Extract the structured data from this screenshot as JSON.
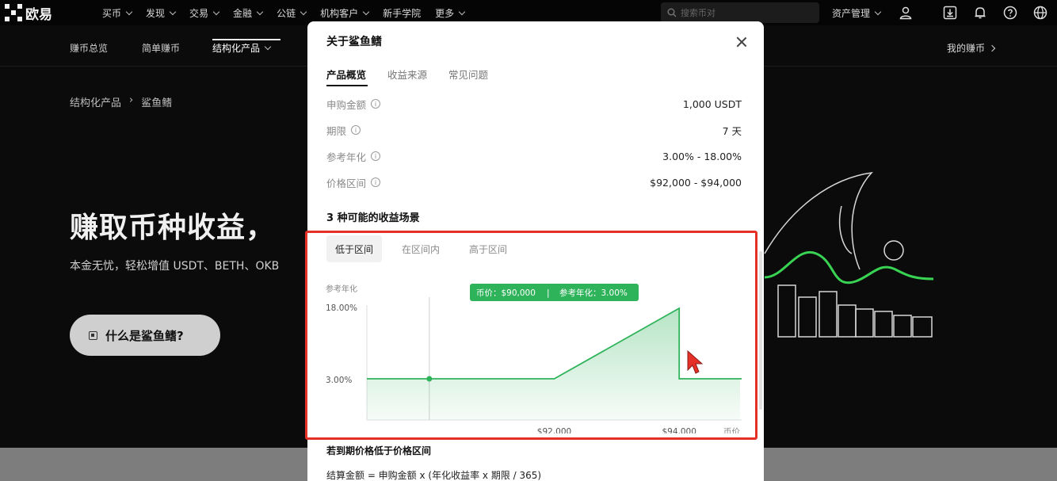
{
  "brand": {
    "name": "欧易"
  },
  "topnav": {
    "items": [
      "买币",
      "发现",
      "交易",
      "金融",
      "公链",
      "机构客户",
      "新手学院",
      "更多"
    ],
    "search_placeholder": "搜索币对",
    "assets_label": "资产管理"
  },
  "subnav": {
    "items": [
      "赚币总览",
      "简单赚币",
      "结构化产品"
    ],
    "my_earn": "我的赚币"
  },
  "hero": {
    "breadcrumb_parent": "结构化产品",
    "breadcrumb_sep": "›",
    "breadcrumb_current": "鲨鱼鳍",
    "title": "赚取币种收益，",
    "subtitle": "本金无忧，轻松增值 USDT、BETH、OKB",
    "button_label": "什么是鲨鱼鳍?"
  },
  "modal": {
    "title": "关于鲨鱼鳍",
    "tabs": [
      "产品概览",
      "收益来源",
      "常见问题"
    ],
    "info": [
      {
        "label": "申购金额",
        "value": "1,000 USDT"
      },
      {
        "label": "期限",
        "value": "7 天"
      },
      {
        "label": "参考年化",
        "value": "3.00% - 18.00%"
      },
      {
        "label": "价格区间",
        "value": "$92,000 - $94,000"
      }
    ],
    "scenario_title": "3 种可能的收益场景",
    "scenario_tabs": [
      "低于区间",
      "在区间内",
      "高于区间"
    ],
    "bottom_title": "若到期价格低于价格区间",
    "bottom_formula": "结算金额 = 申购金额 x (年化收益率 x 期限 / 365)"
  },
  "chart_data": {
    "type": "area",
    "ylabel": "参考年化",
    "xlabel": "币价",
    "y_ticks": [
      "18.00%",
      "3.00%"
    ],
    "x_ticks": [
      "$92,000",
      "$94,000"
    ],
    "x": [
      90000,
      92000,
      94000,
      94000,
      95000
    ],
    "y": [
      3.0,
      3.0,
      18.0,
      3.0,
      3.0
    ],
    "xlim": [
      89000,
      95000
    ],
    "ylim": [
      0,
      20
    ],
    "marker": {
      "x": 90000,
      "y": 3.0
    },
    "tooltip": {
      "price_label": "币价：",
      "price": "$90,000",
      "sep": "|",
      "yield_label": "参考年化：",
      "yield": "3.00%"
    },
    "colors": {
      "line": "#2fb35a",
      "fill": "#2fb35a",
      "tooltip_bg": "#2fb35a"
    }
  },
  "colors": {
    "accent_green": "#2fb35a",
    "highlight_red": "#e53027"
  }
}
